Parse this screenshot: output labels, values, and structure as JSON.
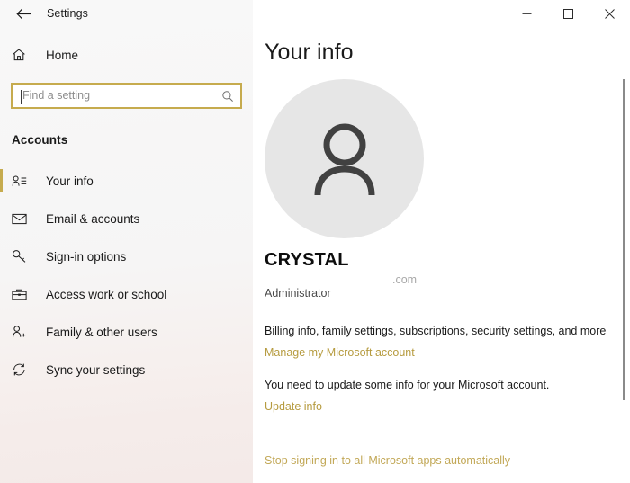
{
  "window": {
    "app_title": "Settings",
    "back_button_label": "Back",
    "controls": {
      "minimize": "Minimize",
      "maximize": "Maximize",
      "close": "Close"
    }
  },
  "sidebar": {
    "home_label": "Home",
    "search": {
      "placeholder": "Find a setting",
      "value": ""
    },
    "section_title": "Accounts",
    "items": [
      {
        "label": "Your info",
        "icon": "contact-card-icon",
        "selected": true
      },
      {
        "label": "Email & accounts",
        "icon": "envelope-icon",
        "selected": false
      },
      {
        "label": "Sign-in options",
        "icon": "key-icon",
        "selected": false
      },
      {
        "label": "Access work or school",
        "icon": "briefcase-icon",
        "selected": false
      },
      {
        "label": "Family & other users",
        "icon": "person-add-icon",
        "selected": false
      },
      {
        "label": "Sync your settings",
        "icon": "sync-icon",
        "selected": false
      }
    ]
  },
  "main": {
    "page_title": "Your info",
    "avatar_icon": "person-avatar-icon",
    "account_name": "CRYSTAL",
    "account_email": ".com",
    "account_role": "Administrator",
    "billing_text": "Billing info, family settings, subscriptions, security settings, and more",
    "manage_account_link": "Manage my Microsoft account",
    "update_notice": "You need to update some info for your Microsoft account.",
    "update_info_link": "Update info",
    "stop_signing_link": "Stop signing in to all Microsoft apps automatically"
  },
  "colors": {
    "accent_gold": "#c6ab4e",
    "link_gold": "#b69b3f",
    "avatar_bg": "#e6e6e6",
    "sidebar_bg": "#f6f5f5"
  }
}
